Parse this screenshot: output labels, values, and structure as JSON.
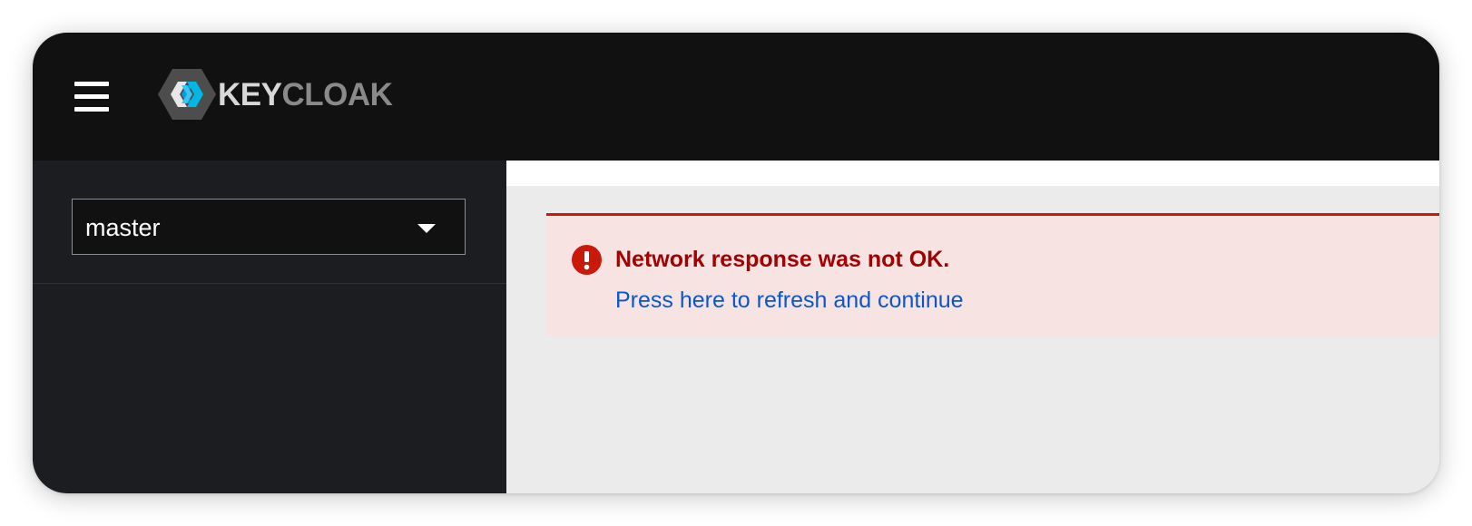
{
  "masthead": {
    "menu_icon": "hamburger-menu-icon",
    "logo": {
      "icon": "keycloak-hexagon-icon",
      "text_part1": "KEY",
      "text_part2": "CLOAK"
    }
  },
  "sidebar": {
    "realm_selector": {
      "value": "master",
      "icon": "caret-down-icon"
    }
  },
  "alert": {
    "variant": "danger",
    "icon": "exclamation-circle-icon",
    "title": "Network response was not OK.",
    "action_link": "Press here to refresh and continue"
  },
  "colors": {
    "masthead_bg": "#111111",
    "sidebar_bg": "#1b1d21",
    "main_bg": "#ebebeb",
    "alert_bg": "#f8e3e3",
    "alert_border": "#c9190b",
    "alert_title": "#a30000",
    "link": "#0b57c9"
  }
}
